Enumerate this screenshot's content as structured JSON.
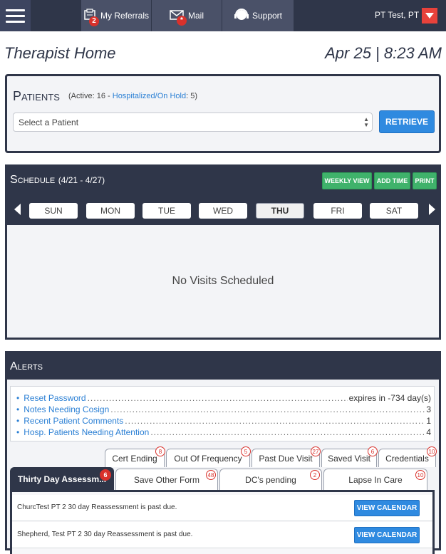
{
  "nav": {
    "referrals": {
      "label": "My Referrals",
      "badge": "2"
    },
    "mail": {
      "label": "Mail",
      "badge": "*"
    },
    "support": {
      "label": "Support"
    },
    "user": "PT Test, PT"
  },
  "header": {
    "title": "Therapist Home",
    "datetime": "Apr 25 | 8:23 AM"
  },
  "patients": {
    "title": "Patients",
    "active_text": "(Active: 16  -",
    "hospitalized_label": "Hospitalized/On Hold",
    "hospitalized_count": ": 5)",
    "select_placeholder": "Select a Patient",
    "retrieve_label": "RETRIEVE"
  },
  "schedule": {
    "title": "Schedule",
    "range": "(4/21 - 4/27)",
    "buttons": {
      "weekly": "WEEKLY VIEW",
      "add_time": "ADD TIME",
      "print": "PRINT"
    },
    "days": [
      "SUN",
      "MON",
      "TUE",
      "WED",
      "THU",
      "FRI",
      "SAT"
    ],
    "selected_day": "THU",
    "empty_message": "No Visits Scheduled"
  },
  "alerts": {
    "title": "Alerts",
    "items": [
      {
        "label": "Reset Password",
        "value": "expires in -734 day(s)"
      },
      {
        "label": "Notes Needing Cosign",
        "value": "3"
      },
      {
        "label": "Recent Patient Comments",
        "value": "1"
      },
      {
        "label": "Hosp. Patients Needing Attention",
        "value": "4"
      }
    ],
    "tabs_row1": [
      {
        "label": "Cert Ending",
        "count": "8"
      },
      {
        "label": "Out Of Frequency",
        "count": "5"
      },
      {
        "label": "Past Due Visit",
        "count": "27"
      },
      {
        "label": "Saved Visit",
        "count": "6"
      },
      {
        "label": "Credentials",
        "count": "10"
      }
    ],
    "tabs_row2": [
      {
        "label": "Thirty Day Assessm...",
        "count": "6"
      },
      {
        "label": "Save Other Form",
        "count": "48"
      },
      {
        "label": "DC's pending",
        "count": "2"
      },
      {
        "label": "Lapse In Care",
        "count": "10"
      }
    ],
    "rows": [
      {
        "message": "ChurcTest PT 2 30 day Reassessment is past due.",
        "button": "VIEW CALENDAR"
      },
      {
        "message": "Shepherd, Test PT 2 30 day Reassessment is past due.",
        "button": "VIEW CALENDAR"
      }
    ]
  },
  "colors": {
    "navy": "#2f3649",
    "accent_blue": "#2f8ae0",
    "green": "#3fb26b",
    "alert_red": "#d9312b"
  }
}
